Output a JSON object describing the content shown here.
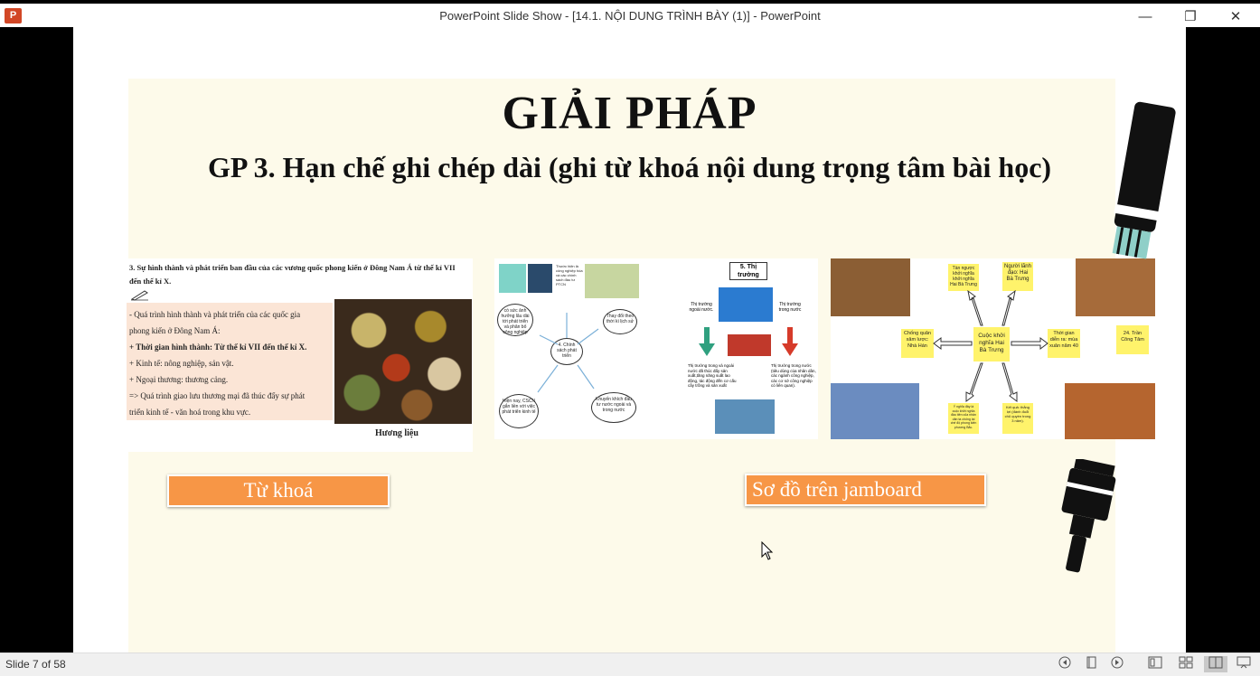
{
  "window": {
    "title": "PowerPoint Slide Show - [14.1. NỘI DUNG TRÌNH BÀY (1)] - PowerPoint",
    "app_icon_letter": "P",
    "minimize": "—",
    "restore": "❐",
    "close": "✕"
  },
  "slide": {
    "heading": "GIẢI PHÁP",
    "subheading": "GP 3. Hạn chế ghi chép dài (ghi từ khoá nội dung trọng tâm bài học)",
    "panel1": {
      "heading": "3. Sự hình thành và phát triển ban đầu của các vương quốc phong kiến ở Đông Nam Á từ thế kỉ VII đến thế kỉ X.",
      "lines": [
        "- Quá trình hình thành và phát triển của các quốc gia",
        "phong kiến ở Đông Nam Á:",
        "+ Thời gian hình thành: Từ thế kỉ VII đến thế kỉ X.",
        "+ Kinh tế: nông nghiệp, sản vật.",
        "+ Ngoại thương: thương cảng.",
        "=> Quá trình giao lưu thương mại đã thúc đẩy sự phát",
        "triển kinh tế - văn hoá trong khu vực."
      ],
      "caption": "Hương liệu"
    },
    "panel2": {
      "center": "4. Chính sách phát triển",
      "market_title": "5. Thị trường",
      "bubbles": [
        "có sức ảnh hưởng lâu dài tới phát triển và phân bố công nghiệp",
        "Thay đổi theo thời kì lịch sử",
        "Hiện nay, CSCN gắn liền với việc phát triển kinh tế",
        "Khuyến khích đầu tư nước ngoài và trong nước"
      ],
      "labels": {
        "note_top": "Thước hiện là công nghiệp hóa và các chính sách đầu tư PTCN",
        "market_out": "Thị trường ngoài nước.",
        "market_in": "Thị trường trong nước",
        "note_left": "Thị trường trong và ngoài nước đã thúc đẩy sản xuất,tăng năng suất lao động, tác động đến cơ cấu cây trồng và sản xuất",
        "note_right": "Thị trường trong nước (tiêu dùng của nhân dân, các ngành công nghiệp, các cơ sở công nghiệp có liên quan)."
      }
    },
    "panel3": {
      "center": "Cuộc khởi nghĩa Hai Bà Trưng",
      "nodes": [
        "Tàn ngược khởi nghĩa khởi nghĩa Hai Bà Trưng",
        "Người lãnh đạo: Hai Bà Trưng",
        "Chống quân xâm lược: Nhà Hán",
        "Thời gian diễn ra: mùa xuân năm 40",
        "24. Trần Công Tâm",
        "Ý nghĩa đây là cuộc khởi nghĩa đầu tiên của nhân dân ta chống lại chế độ phong kiến phương Bắc.",
        "Kết quả: thắng lợi (đánh đuổi chủ quyền trong 3 năm)."
      ]
    },
    "button_keywords": "Từ khoá",
    "button_jamboard": "Sơ đồ trên jamboard"
  },
  "status": {
    "slide_count": "Slide 7 of 58",
    "icons": [
      "previous-icon",
      "slide-menu-icon",
      "next-icon",
      "normal-view-icon",
      "slide-sorter-icon",
      "reading-view-icon",
      "slideshow-icon"
    ]
  }
}
